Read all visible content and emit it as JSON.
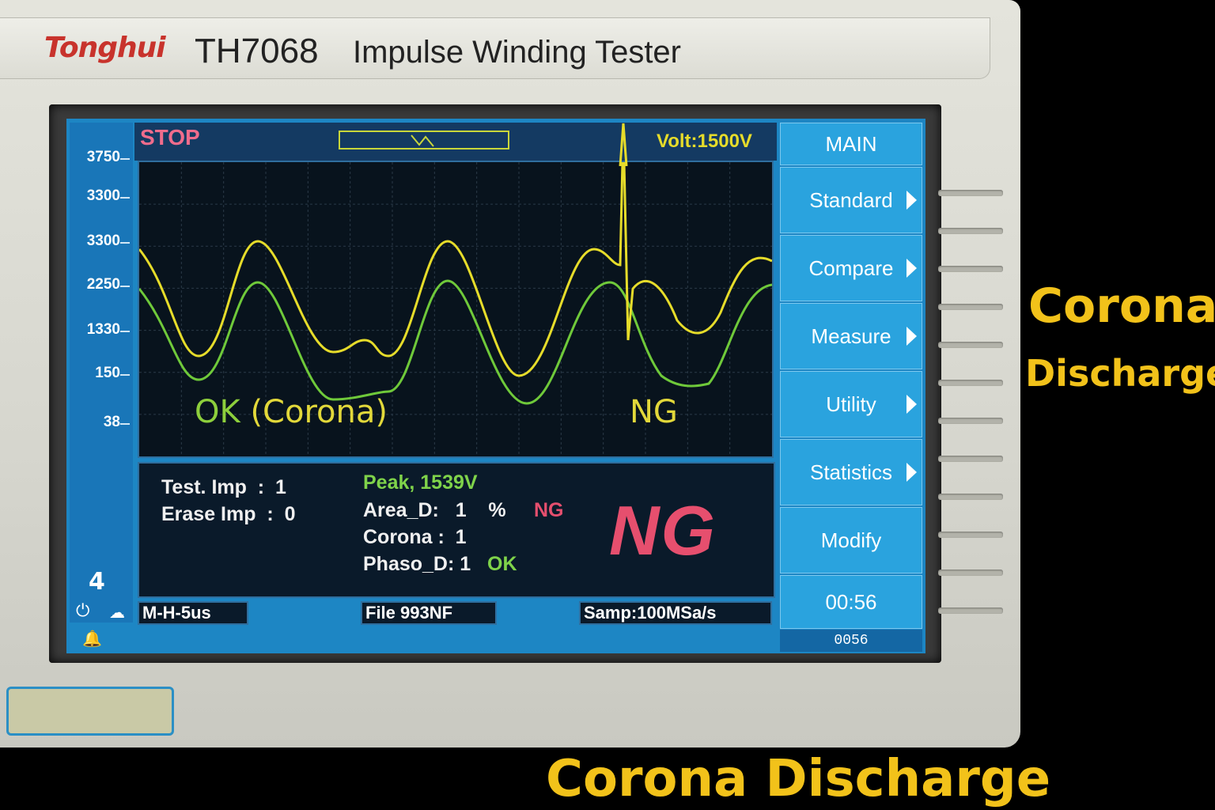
{
  "device": {
    "brand": "Tonghui",
    "model": "TH7068",
    "name": "Impulse Winding Tester"
  },
  "header": {
    "state": "STOP",
    "volt": "Volt:1500V"
  },
  "y_axis": {
    "ticks": [
      "3750",
      "3300",
      "3300",
      "2250",
      "1330",
      "150",
      "38"
    ]
  },
  "waveform": {
    "ok_label": "OK",
    "ok_label_corona": "(Corona)",
    "ng_label": "NG",
    "colors": {
      "reference": "#6fc93a",
      "test": "#e6dc2a"
    }
  },
  "info": {
    "test_imp": "Test. Imp  :  1",
    "erase_imp": "Erase Imp  :  0",
    "peak": "Peak, 1539V",
    "area_d": "Area_D:   1    %",
    "area_d_result": "NG",
    "corona": "Corona :  1",
    "phaso_d": "Phaso_D: 1",
    "phaso_d_result": "OK",
    "result": "NG"
  },
  "status": {
    "mode": "M-H-5us",
    "file": "File 993NF",
    "samp": "Samp:100MSa/s"
  },
  "side_indicator": "4",
  "menu": {
    "title": "MAIN",
    "items": [
      {
        "label": "Standard",
        "arrow": true
      },
      {
        "label": "Compare",
        "arrow": true
      },
      {
        "label": "Measure",
        "arrow": true
      },
      {
        "label": "Utility",
        "arrow": true
      },
      {
        "label": "Statistics",
        "arrow": true
      },
      {
        "label": "Modify",
        "arrow": false
      }
    ],
    "time": "00:56",
    "counter": "0056"
  },
  "captions": {
    "right_line1": "Corona",
    "right_line2": "Discharge",
    "bottom": "Corona Discharge"
  }
}
